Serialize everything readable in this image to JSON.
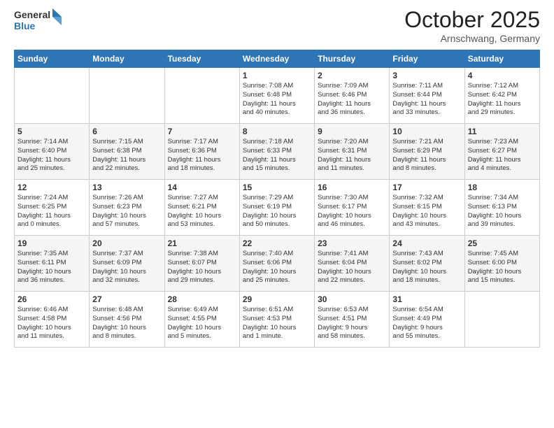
{
  "header": {
    "logo_general": "General",
    "logo_blue": "Blue",
    "month_title": "October 2025",
    "location": "Arnschwang, Germany"
  },
  "weekdays": [
    "Sunday",
    "Monday",
    "Tuesday",
    "Wednesday",
    "Thursday",
    "Friday",
    "Saturday"
  ],
  "weeks": [
    [
      {
        "day": "",
        "info": ""
      },
      {
        "day": "",
        "info": ""
      },
      {
        "day": "",
        "info": ""
      },
      {
        "day": "1",
        "info": "Sunrise: 7:08 AM\nSunset: 6:48 PM\nDaylight: 11 hours\nand 40 minutes."
      },
      {
        "day": "2",
        "info": "Sunrise: 7:09 AM\nSunset: 6:46 PM\nDaylight: 11 hours\nand 36 minutes."
      },
      {
        "day": "3",
        "info": "Sunrise: 7:11 AM\nSunset: 6:44 PM\nDaylight: 11 hours\nand 33 minutes."
      },
      {
        "day": "4",
        "info": "Sunrise: 7:12 AM\nSunset: 6:42 PM\nDaylight: 11 hours\nand 29 minutes."
      }
    ],
    [
      {
        "day": "5",
        "info": "Sunrise: 7:14 AM\nSunset: 6:40 PM\nDaylight: 11 hours\nand 25 minutes."
      },
      {
        "day": "6",
        "info": "Sunrise: 7:15 AM\nSunset: 6:38 PM\nDaylight: 11 hours\nand 22 minutes."
      },
      {
        "day": "7",
        "info": "Sunrise: 7:17 AM\nSunset: 6:36 PM\nDaylight: 11 hours\nand 18 minutes."
      },
      {
        "day": "8",
        "info": "Sunrise: 7:18 AM\nSunset: 6:33 PM\nDaylight: 11 hours\nand 15 minutes."
      },
      {
        "day": "9",
        "info": "Sunrise: 7:20 AM\nSunset: 6:31 PM\nDaylight: 11 hours\nand 11 minutes."
      },
      {
        "day": "10",
        "info": "Sunrise: 7:21 AM\nSunset: 6:29 PM\nDaylight: 11 hours\nand 8 minutes."
      },
      {
        "day": "11",
        "info": "Sunrise: 7:23 AM\nSunset: 6:27 PM\nDaylight: 11 hours\nand 4 minutes."
      }
    ],
    [
      {
        "day": "12",
        "info": "Sunrise: 7:24 AM\nSunset: 6:25 PM\nDaylight: 11 hours\nand 0 minutes."
      },
      {
        "day": "13",
        "info": "Sunrise: 7:26 AM\nSunset: 6:23 PM\nDaylight: 10 hours\nand 57 minutes."
      },
      {
        "day": "14",
        "info": "Sunrise: 7:27 AM\nSunset: 6:21 PM\nDaylight: 10 hours\nand 53 minutes."
      },
      {
        "day": "15",
        "info": "Sunrise: 7:29 AM\nSunset: 6:19 PM\nDaylight: 10 hours\nand 50 minutes."
      },
      {
        "day": "16",
        "info": "Sunrise: 7:30 AM\nSunset: 6:17 PM\nDaylight: 10 hours\nand 46 minutes."
      },
      {
        "day": "17",
        "info": "Sunrise: 7:32 AM\nSunset: 6:15 PM\nDaylight: 10 hours\nand 43 minutes."
      },
      {
        "day": "18",
        "info": "Sunrise: 7:34 AM\nSunset: 6:13 PM\nDaylight: 10 hours\nand 39 minutes."
      }
    ],
    [
      {
        "day": "19",
        "info": "Sunrise: 7:35 AM\nSunset: 6:11 PM\nDaylight: 10 hours\nand 36 minutes."
      },
      {
        "day": "20",
        "info": "Sunrise: 7:37 AM\nSunset: 6:09 PM\nDaylight: 10 hours\nand 32 minutes."
      },
      {
        "day": "21",
        "info": "Sunrise: 7:38 AM\nSunset: 6:07 PM\nDaylight: 10 hours\nand 29 minutes."
      },
      {
        "day": "22",
        "info": "Sunrise: 7:40 AM\nSunset: 6:06 PM\nDaylight: 10 hours\nand 25 minutes."
      },
      {
        "day": "23",
        "info": "Sunrise: 7:41 AM\nSunset: 6:04 PM\nDaylight: 10 hours\nand 22 minutes."
      },
      {
        "day": "24",
        "info": "Sunrise: 7:43 AM\nSunset: 6:02 PM\nDaylight: 10 hours\nand 18 minutes."
      },
      {
        "day": "25",
        "info": "Sunrise: 7:45 AM\nSunset: 6:00 PM\nDaylight: 10 hours\nand 15 minutes."
      }
    ],
    [
      {
        "day": "26",
        "info": "Sunrise: 6:46 AM\nSunset: 4:58 PM\nDaylight: 10 hours\nand 11 minutes."
      },
      {
        "day": "27",
        "info": "Sunrise: 6:48 AM\nSunset: 4:56 PM\nDaylight: 10 hours\nand 8 minutes."
      },
      {
        "day": "28",
        "info": "Sunrise: 6:49 AM\nSunset: 4:55 PM\nDaylight: 10 hours\nand 5 minutes."
      },
      {
        "day": "29",
        "info": "Sunrise: 6:51 AM\nSunset: 4:53 PM\nDaylight: 10 hours\nand 1 minute."
      },
      {
        "day": "30",
        "info": "Sunrise: 6:53 AM\nSunset: 4:51 PM\nDaylight: 9 hours\nand 58 minutes."
      },
      {
        "day": "31",
        "info": "Sunrise: 6:54 AM\nSunset: 4:49 PM\nDaylight: 9 hours\nand 55 minutes."
      },
      {
        "day": "",
        "info": ""
      }
    ]
  ]
}
